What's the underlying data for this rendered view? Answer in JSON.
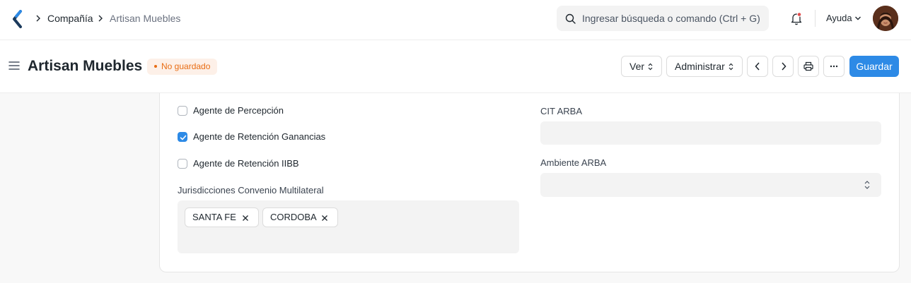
{
  "navbar": {
    "breadcrumbs": [
      "Compañía",
      "Artisan Muebles"
    ],
    "search_placeholder": "Ingresar búsqueda o comando (Ctrl + G)",
    "help_label": "Ayuda"
  },
  "page": {
    "title": "Artisan Muebles",
    "status_badge": "No guardado",
    "buttons": {
      "view": "Ver",
      "manage": "Administrar",
      "save": "Guardar"
    }
  },
  "form": {
    "checkboxes": [
      {
        "label": "Agente de Percepción",
        "checked": false
      },
      {
        "label": "Agente de Retención Ganancias",
        "checked": true
      },
      {
        "label": "Agente de Retención IIBB",
        "checked": false
      }
    ],
    "multiselect": {
      "label": "Jurisdicciones Convenio Multilateral",
      "values": [
        "SANTA FE",
        "CORDOBA"
      ]
    },
    "cit_arba": {
      "label": "CIT ARBA",
      "value": ""
    },
    "ambiente_arba": {
      "label": "Ambiente ARBA",
      "value": ""
    }
  },
  "colors": {
    "primary": "#2d8ae6",
    "badge_text": "#e86c13",
    "badge_bg": "#fdf0e8"
  }
}
